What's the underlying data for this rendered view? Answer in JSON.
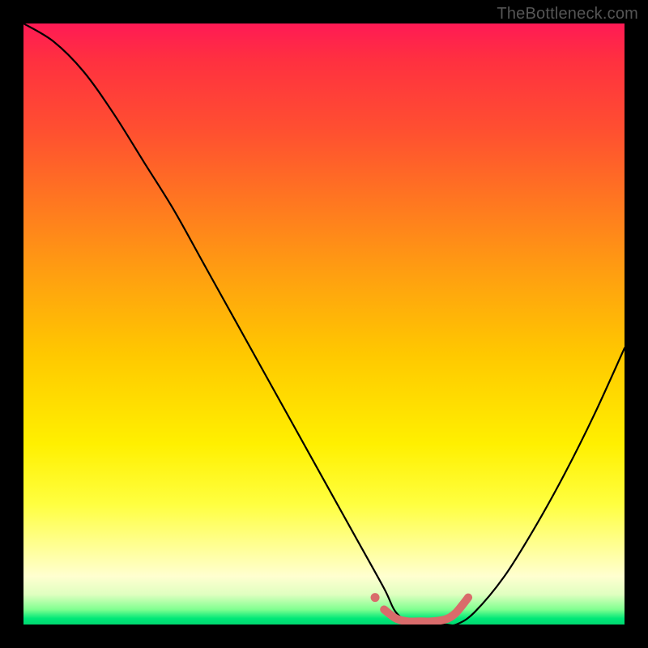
{
  "watermark": "TheBottleneck.com",
  "chart_data": {
    "type": "line",
    "title": "",
    "xlabel": "",
    "ylabel": "",
    "xlim": [
      0,
      100
    ],
    "ylim": [
      0,
      100
    ],
    "series": [
      {
        "name": "bottleneck-curve",
        "x": [
          0,
          5,
          10,
          15,
          20,
          25,
          30,
          35,
          40,
          45,
          50,
          55,
          60,
          62,
          65,
          70,
          72,
          75,
          80,
          85,
          90,
          95,
          100
        ],
        "y": [
          100,
          97,
          92,
          85,
          77,
          69,
          60,
          51,
          42,
          33,
          24,
          15,
          6,
          2,
          0,
          0,
          0,
          2,
          8,
          16,
          25,
          35,
          46
        ],
        "color": "#000000"
      },
      {
        "name": "optimal-marker",
        "x": [
          60,
          62,
          64,
          66,
          68,
          70,
          71,
          72,
          73,
          74
        ],
        "y": [
          2.5,
          1,
          0.5,
          0.5,
          0.5,
          0.8,
          1.2,
          2,
          3.2,
          4.5
        ],
        "color": "#d96b6b",
        "thick": true
      }
    ]
  }
}
